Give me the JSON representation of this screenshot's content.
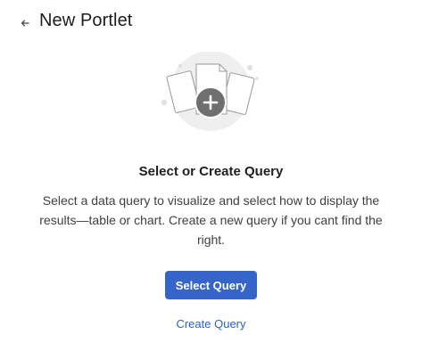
{
  "header": {
    "back_icon": "arrow-left-icon",
    "title": "New Portlet"
  },
  "illustration": {
    "icon": "add-document-illustration",
    "colors": {
      "circle": "#ededed",
      "plus_badge": "#707070",
      "paper": "#ffffff",
      "outline": "#9a9a9a"
    }
  },
  "empty_state": {
    "heading": "Select or Create Query",
    "description": "Select a data query to visualize and select how to display the results—table or chart. Create a new query if you cant find the right."
  },
  "actions": {
    "select_query_label": "Select Query",
    "create_query_label": "Create Query",
    "primary_color": "#3565c9",
    "link_color": "#2c62c6"
  }
}
